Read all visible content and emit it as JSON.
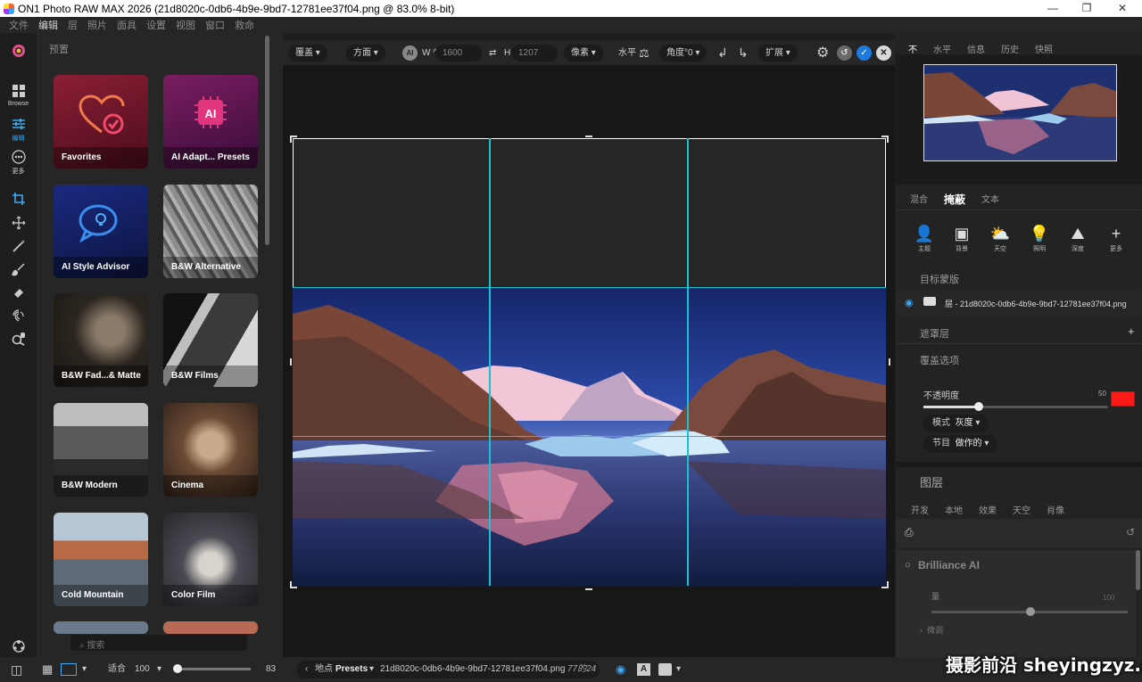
{
  "window": {
    "title": "ON1 Photo RAW MAX 2026 (21d8020c-0db6-4b9e-9bd7-12781ee37f04.png @ 83.0% 8-bit)",
    "controls": [
      "—",
      "❐",
      "✕"
    ]
  },
  "menu": [
    "文件",
    "编辑",
    "层",
    "照片",
    "面具",
    "设置",
    "视图",
    "窗口",
    "救命"
  ],
  "left_tools": {
    "browse_label": "Browse",
    "edit_label": "编辑",
    "more_label": "更多"
  },
  "presets": {
    "header": "预置",
    "items": [
      {
        "label": "Favorites",
        "color": "#7a1a2e"
      },
      {
        "label": "AI Adapt... Presets",
        "color": "#6a1a54"
      },
      {
        "label": "AI Style Advisor",
        "color": "#18256e"
      },
      {
        "label": "B&W Alternative",
        "color": "#6e6e6e"
      },
      {
        "label": "B&W Fad...& Matte",
        "color": "#3a3128"
      },
      {
        "label": "B&W Films",
        "color": "#3d3d3d"
      },
      {
        "label": "B&W Modern",
        "color": "#4a4a4a"
      },
      {
        "label": "Cinema",
        "color": "#4c3a2e"
      },
      {
        "label": "Cold Mountain",
        "color": "#5c6c7a"
      },
      {
        "label": "Color Film",
        "color": "#3a3a40"
      }
    ],
    "search_placeholder": "搜索"
  },
  "crop_toolbar": {
    "overlay": "覆盖",
    "orientation": "方面",
    "ai_label": "AI",
    "w_label": "W ^",
    "w_value": "1600",
    "swap": "⇄",
    "h_label": "H",
    "h_value": "1207",
    "unit": "像素",
    "level": "水平",
    "angle": "角度°0",
    "expand": "扩展"
  },
  "right_panel": {
    "top_tabs": [
      "不",
      "水平",
      "信息",
      "历史",
      "快照"
    ],
    "mask_tabs": [
      "混合",
      "掩蔽",
      "文本"
    ],
    "mask_tools": [
      "主题",
      "背景",
      "天空",
      "照明",
      "深度",
      "更多"
    ],
    "target_mask_title": "目标蒙版",
    "layer_name": "层 - 21d8020c-0db6-4b9e-9bd7-12781ee37f04.png",
    "mask_layer_title": "遮罩层",
    "overlay_options_title": "覆盖选项",
    "opacity_label": "不透明度",
    "opacity_value": "50",
    "mode_label": "模式",
    "mode_value": "灰度",
    "section_label": "节目",
    "section_value": "做作的",
    "layers_title": "图层",
    "layer_tabs": [
      "开发",
      "本地",
      "效果",
      "天空",
      "肖像"
    ],
    "brilliance_title": "Brilliance AI",
    "amount_label": "量",
    "amount_value": "100",
    "fine_tune": "微调",
    "overlay_color": "#ff1a1a"
  },
  "status_bar": {
    "fit": "适合",
    "zoom": "100",
    "zoom_slider": "83",
    "location_label": "地点",
    "presets_label": "Presets",
    "filename": "21d8020c-0db6-4b9e-9bd7-12781ee37f04.png",
    "count": "77的24"
  },
  "watermark": "摄影前沿 sheyingzyz.com"
}
